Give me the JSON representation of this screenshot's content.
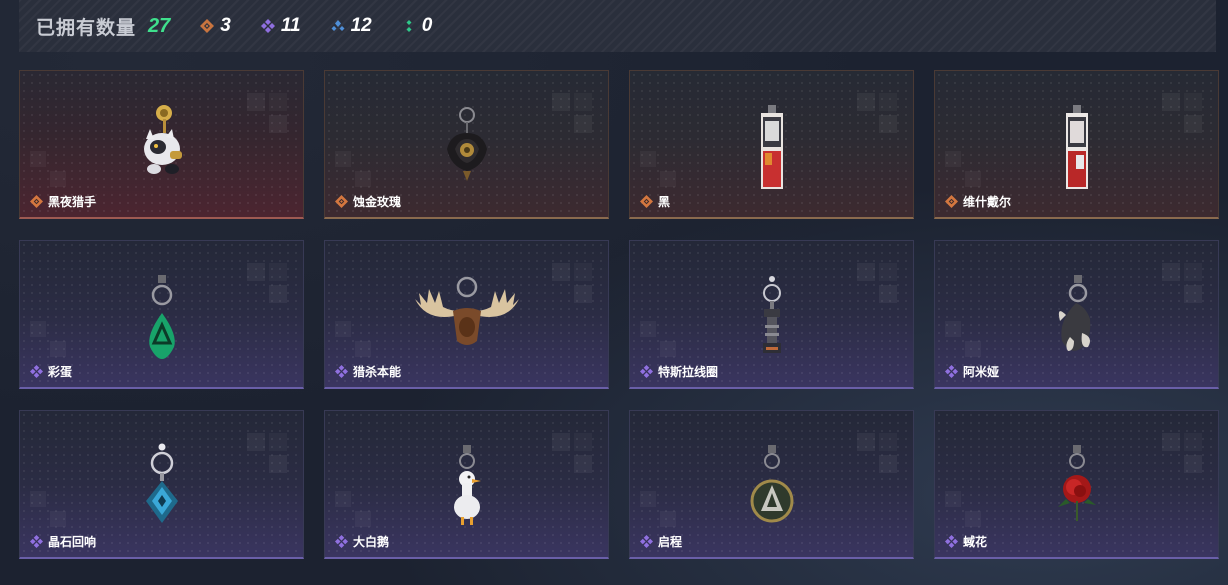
{
  "header": {
    "owned_label": "已拥有数量",
    "owned_count": "27",
    "stats": [
      {
        "icon": "orange-diamond-icon",
        "value": "3",
        "color": "#c8743f"
      },
      {
        "icon": "purple-clover-icon",
        "value": "11",
        "color": "#8f6fe0"
      },
      {
        "icon": "blue-diamonds-icon",
        "value": "12",
        "color": "#4f8fd8"
      },
      {
        "icon": "green-dots-icon",
        "value": "0",
        "color": "#2fc98a"
      }
    ]
  },
  "items": [
    {
      "name": "黑夜猎手",
      "rarity": "orange",
      "icon": "black-cat-charm-icon"
    },
    {
      "name": "蚀金玫瑰",
      "rarity": "orange",
      "icon": "black-gold-rose-charm-icon"
    },
    {
      "name": "黑",
      "rarity": "orange",
      "icon": "card-tag-charm-icon"
    },
    {
      "name": "维什戴尔",
      "rarity": "orange",
      "icon": "card-tag-charm-icon"
    },
    {
      "name": "彩蛋",
      "rarity": "purple",
      "icon": "green-egg-charm-icon"
    },
    {
      "name": "猎杀本能",
      "rarity": "purple",
      "icon": "moose-antler-charm-icon"
    },
    {
      "name": "特斯拉线圈",
      "rarity": "purple",
      "icon": "tesla-coil-charm-icon"
    },
    {
      "name": "阿米娅",
      "rarity": "purple",
      "icon": "bunny-charm-icon"
    },
    {
      "name": "晶石回响",
      "rarity": "purple",
      "icon": "crystal-charm-icon"
    },
    {
      "name": "大白鹅",
      "rarity": "purple",
      "icon": "goose-charm-icon"
    },
    {
      "name": "启程",
      "rarity": "purple",
      "icon": "medallion-charm-icon"
    },
    {
      "name": "蜮花",
      "rarity": "purple",
      "icon": "red-rose-charm-icon"
    }
  ],
  "colors": {
    "orange_rarity": "#d4773f",
    "purple_rarity": "#9070e0",
    "owned_count": "#3fe08d"
  }
}
